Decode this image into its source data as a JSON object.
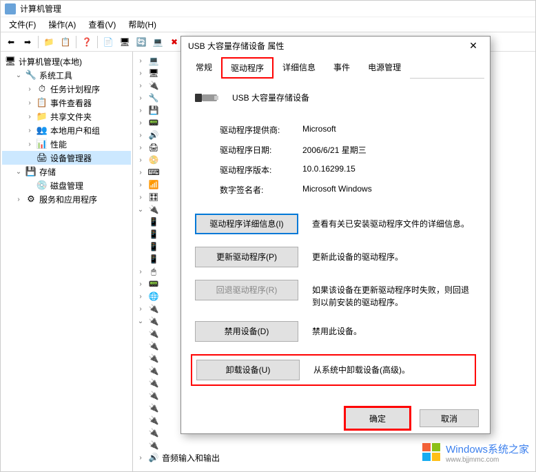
{
  "window": {
    "title": "计算机管理"
  },
  "menu": {
    "file": "文件(F)",
    "action": "操作(A)",
    "view": "查看(V)",
    "help": "帮助(H)"
  },
  "tree": {
    "root": "计算机管理(本地)",
    "system_tools": "系统工具",
    "task_scheduler": "任务计划程序",
    "event_viewer": "事件查看器",
    "shared_folders": "共享文件夹",
    "local_users": "本地用户和组",
    "performance": "性能",
    "device_manager": "设备管理器",
    "storage": "存储",
    "disk_mgmt": "磁盘管理",
    "services_apps": "服务和应用程序"
  },
  "device_list": {
    "audio": "音频输入和输出"
  },
  "dialog": {
    "title": "USB 大容量存储设备 属性",
    "tabs": {
      "general": "常规",
      "driver": "驱动程序",
      "details": "详细信息",
      "events": "事件",
      "power": "电源管理"
    },
    "device_name": "USB 大容量存储设备",
    "info": {
      "provider_label": "驱动程序提供商:",
      "provider_value": "Microsoft",
      "date_label": "驱动程序日期:",
      "date_value": "2006/6/21 星期三",
      "version_label": "驱动程序版本:",
      "version_value": "10.0.16299.15",
      "signer_label": "数字签名者:",
      "signer_value": "Microsoft Windows"
    },
    "buttons": {
      "details": "驱动程序详细信息(I)",
      "details_desc": "查看有关已安装驱动程序文件的详细信息。",
      "update": "更新驱动程序(P)",
      "update_desc": "更新此设备的驱动程序。",
      "rollback": "回退驱动程序(R)",
      "rollback_desc": "如果该设备在更新驱动程序时失败，则回退到以前安装的驱动程序。",
      "disable": "禁用设备(D)",
      "disable_desc": "禁用此设备。",
      "uninstall": "卸载设备(U)",
      "uninstall_desc": "从系统中卸载设备(高级)。"
    },
    "footer": {
      "ok": "确定",
      "cancel": "取消"
    }
  },
  "watermark": {
    "line1": "Windows系统之家",
    "line2": "www.bjjmmc.com"
  }
}
